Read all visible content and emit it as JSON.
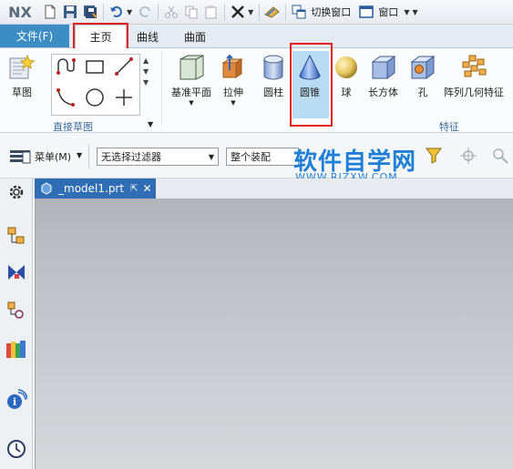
{
  "app": {
    "logo": "NX"
  },
  "quick_access": {
    "switch_window_label": "切换窗口",
    "window_label": "窗口"
  },
  "tabs": {
    "file": "文件(F)",
    "home": "主页",
    "curve": "曲线",
    "surface": "曲面"
  },
  "ribbon": {
    "sketch_label": "草图",
    "direct_sketch_group": "直接草图",
    "datum_plane": "基准平面",
    "extrude": "拉伸",
    "cylinder": "圆柱",
    "cone": "圆锥",
    "sphere": "球",
    "block": "长方体",
    "hole": "孔",
    "pattern_geometry": "阵列几何特征",
    "feature_group": "特征"
  },
  "toolbar2": {
    "menu_label": "菜单(M)",
    "filter_value": "无选择过滤器",
    "assembly_value": "整个装配"
  },
  "watermark": {
    "title": "软件自学网",
    "url": "WWW.RJZXW.COM"
  },
  "document": {
    "tab_name": "_model1.prt"
  },
  "colors": {
    "accent_blue": "#3c8dc4",
    "highlight_red": "#e52222",
    "cone_selected_bg": "#b9dcf2"
  }
}
